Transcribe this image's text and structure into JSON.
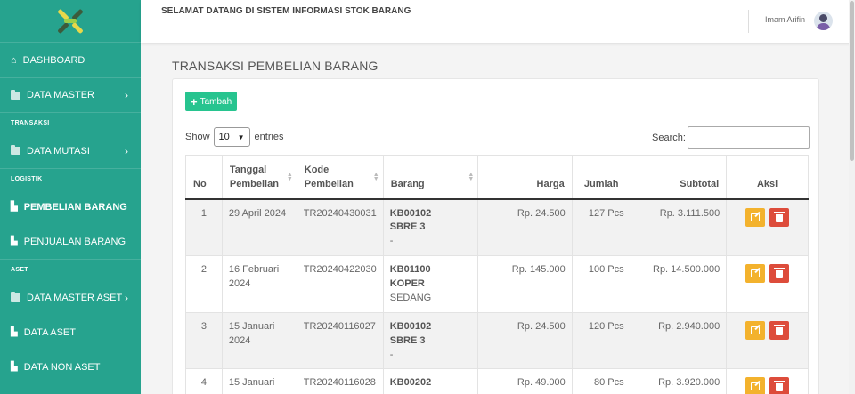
{
  "header": {
    "welcome": "SELAMAT DATANG DI SISTEM INFORMASI STOK BARANG",
    "user_name": "Imam Arifin"
  },
  "sidebar": {
    "items": [
      {
        "label": "DASHBOARD"
      },
      {
        "label": "DATA MASTER"
      },
      {
        "section": "TRANSAKSI"
      },
      {
        "label": "DATA MUTASI"
      },
      {
        "section": "LOGISTIK"
      },
      {
        "label": "PEMBELIAN BARANG"
      },
      {
        "label": "PENJUALAN BARANG"
      },
      {
        "section": "ASET"
      },
      {
        "label": "DATA MASTER ASET"
      },
      {
        "label": "DATA ASET"
      },
      {
        "label": "DATA NON ASET"
      }
    ],
    "accent": "#26a38e"
  },
  "main": {
    "title": "TRANSAKSI PEMBELIAN BARANG",
    "add_button": "Tambah",
    "show_label": "Show",
    "entries_value": "10",
    "entries_label": "entries",
    "search_label": "Search:",
    "search_value": ""
  },
  "table": {
    "headers": [
      "No",
      "Tanggal Pembelian",
      "Kode Pembelian",
      "Barang",
      "Harga",
      "Jumlah",
      "Subtotal",
      "Aksi"
    ],
    "rows": [
      {
        "no": "1",
        "tanggal": "29 April 2024",
        "kode": "TR20240430031",
        "barang_kode": "KB00102",
        "barang_nama": "SBRE 3",
        "barang_ket": "-",
        "harga": "Rp. 24.500",
        "jumlah": "127 Pcs",
        "subtotal": "Rp. 3.111.500"
      },
      {
        "no": "2",
        "tanggal": "16 Februari 2024",
        "kode": "TR20240422030",
        "barang_kode": "KB01100",
        "barang_nama": "KOPER",
        "barang_ket": "SEDANG",
        "harga": "Rp. 145.000",
        "jumlah": "100 Pcs",
        "subtotal": "Rp. 14.500.000"
      },
      {
        "no": "3",
        "tanggal": "15 Januari 2024",
        "kode": "TR20240116027",
        "barang_kode": "KB00102",
        "barang_nama": "SBRE 3",
        "barang_ket": "-",
        "harga": "Rp. 24.500",
        "jumlah": "120 Pcs",
        "subtotal": "Rp. 2.940.000"
      },
      {
        "no": "4",
        "tanggal": "15 Januari",
        "kode": "TR20240116028",
        "barang_kode": "KB00202",
        "barang_nama": "",
        "barang_ket": "",
        "harga": "Rp. 49.000",
        "jumlah": "80 Pcs",
        "subtotal": "Rp. 3.920.000"
      }
    ]
  },
  "colors": {
    "add": "#27c48f",
    "edit": "#f3b22d",
    "delete": "#dd4c3b"
  }
}
